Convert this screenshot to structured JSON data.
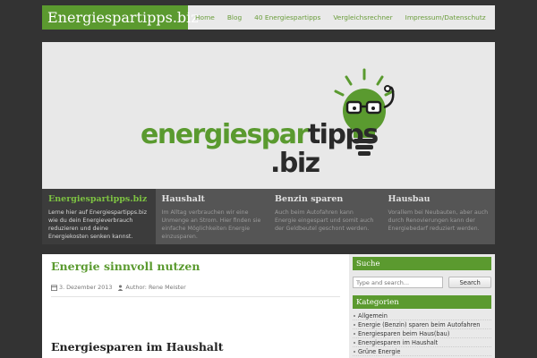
{
  "header": {
    "site_title": "Energiespartipps.biz",
    "nav": [
      "Home",
      "Blog",
      "40 Energiespartipps",
      "Vergleichsrechner",
      "Impressum/Datenschutz"
    ]
  },
  "banner": {
    "logo_part1": "energiespar",
    "logo_part2": "tipps",
    "logo_part3": ".biz",
    "accent_color": "#5a9a2f"
  },
  "tabs": [
    {
      "title": "Energiespartipps.biz",
      "text": "Lerne hier auf Energiespartipps.biz wie du dein Energieverbrauch reduzieren und deine Energiekosten senken kannst."
    },
    {
      "title": "Haushalt",
      "text": "Im Alltag verbrauchen wir eine Unmenge an Strom. Hier finden sie einfache Möglichkeiten Energie einzusparen."
    },
    {
      "title": "Benzin sparen",
      "text": "Auch beim Autofahren kann Energie eingespart und somit auch der Geldbeutel geschont werden."
    },
    {
      "title": "Hausbau",
      "text": "Vorallem bei Neubauten, aber auch durch Renovierungen kann der Energiebedarf reduziert werden."
    }
  ],
  "main": {
    "post_title": "Energie sinnvoll nutzen",
    "date": "3. Dezember 2013",
    "author": "Author: Rene Meister",
    "post_title2": "Energiesparen im Haushalt"
  },
  "sidebar": {
    "search_title": "Suche",
    "search_placeholder": "Type and search...",
    "search_button": "Search",
    "categories_title": "Kategorien",
    "categories": [
      "Allgemein",
      "Energie (Benzin) sparen beim Autofahren",
      "Energiesparen beim Haus(bau)",
      "Energiesparen im Haushalt",
      "Grüne Energie"
    ]
  }
}
